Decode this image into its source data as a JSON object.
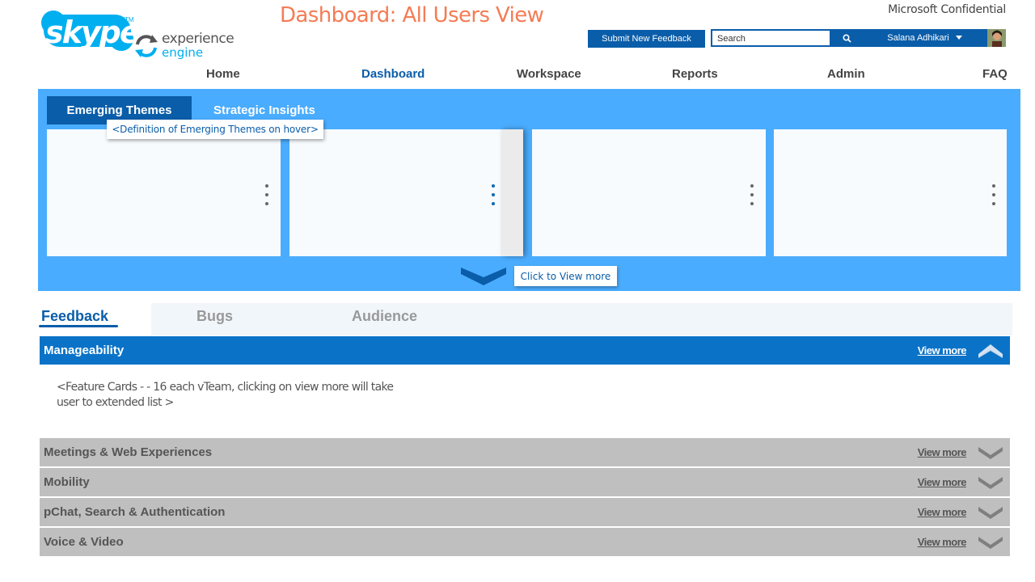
{
  "branding": {
    "logo_text": "skype",
    "logo_tm": "TM",
    "subtitle_line1": "experience",
    "subtitle_line2": "engine"
  },
  "page": {
    "title": "Dashboard: All Users View",
    "confidential": "Microsoft Confidential"
  },
  "header": {
    "feedback_button": "Submit New Feedback",
    "search_placeholder": "Search",
    "search_icon": "search-icon",
    "user_name": "Salana Adhikari",
    "user_menu_icon": "caret-down-icon"
  },
  "nav": {
    "items": [
      {
        "label": "Home"
      },
      {
        "label": "Dashboard",
        "active": true
      },
      {
        "label": "Workspace"
      },
      {
        "label": "Reports"
      },
      {
        "label": "Admin"
      },
      {
        "label": "FAQ"
      }
    ]
  },
  "themes": {
    "tabs": [
      {
        "label": "Emerging Themes",
        "active": true
      },
      {
        "label": "Strategic Insights"
      }
    ],
    "hover_tooltip": "<Definition  of Emerging Themes on hover>",
    "view_more_label": "Click to View more",
    "card_count": 4
  },
  "feedback": {
    "tabs": [
      {
        "label": "Feedback",
        "active": true
      },
      {
        "label": "Bugs"
      },
      {
        "label": "Audience"
      }
    ],
    "sections": [
      {
        "title": "Manageability",
        "view_more": "View more",
        "expanded": true,
        "body": "<Feature Cards - - 16 each vTeam, clicking on view more will take user to extended list >"
      },
      {
        "title": "Meetings & Web Experiences",
        "view_more": "View more",
        "expanded": false
      },
      {
        "title": "Mobility",
        "view_more": "View more",
        "expanded": false
      },
      {
        "title": "pChat, Search & Authentication",
        "view_more": "View more",
        "expanded": false
      },
      {
        "title": "Voice & Video",
        "view_more": "View more",
        "expanded": false
      }
    ]
  },
  "colors": {
    "brand_blue": "#0a5da9",
    "panel_blue": "#4aacfe",
    "title_orange": "#f47c55",
    "skype_cyan": "#00aff0",
    "collapsed_gray": "#bfbfbf"
  }
}
